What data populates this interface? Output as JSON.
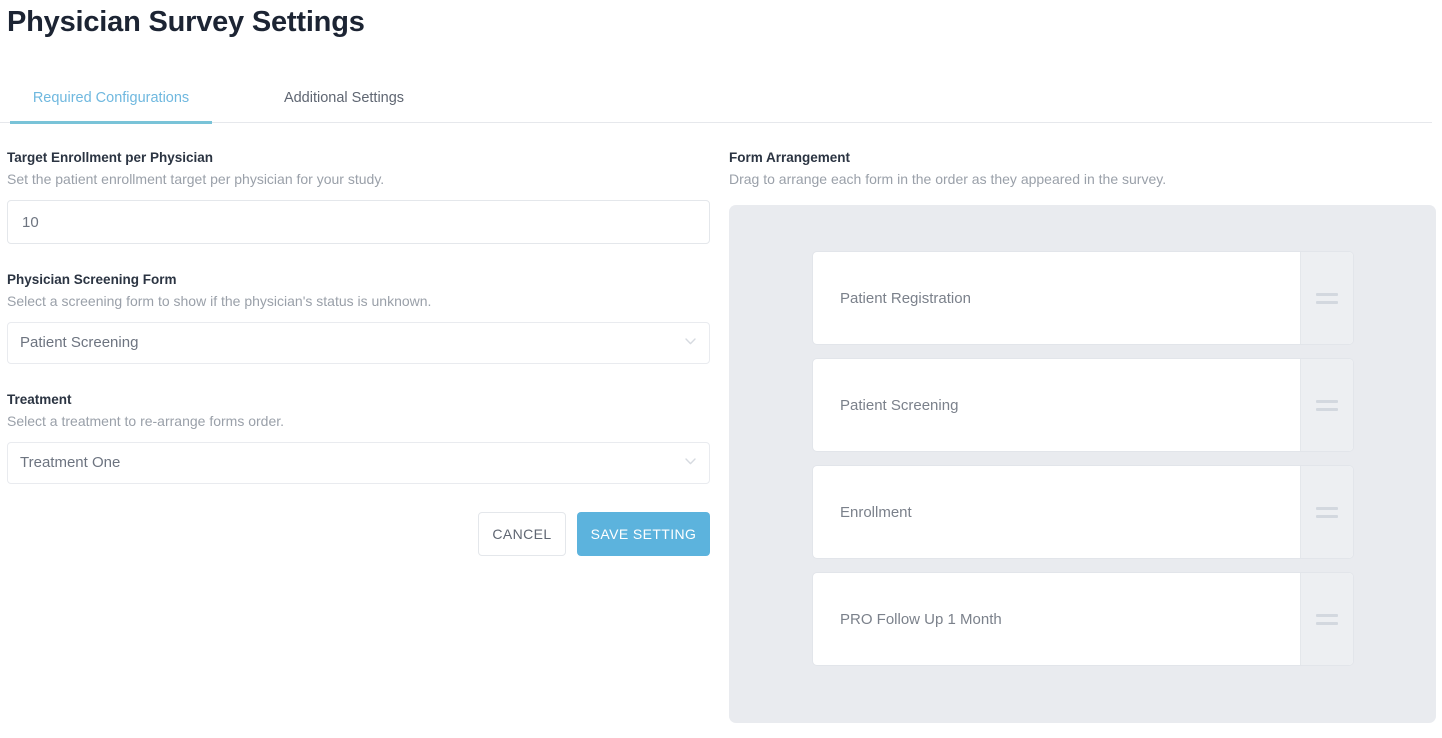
{
  "page": {
    "title": "Physician Survey Settings"
  },
  "tabs": [
    {
      "label": "Required Configurations",
      "active": true
    },
    {
      "label": "Additional Settings",
      "active": false
    }
  ],
  "left_column": {
    "target_enrollment": {
      "label": "Target Enrollment per Physician",
      "description": "Set the patient enrollment target per physician for your study.",
      "value": "10"
    },
    "screening_form": {
      "label": "Physician Screening Form",
      "description": "Select a screening form to show if the physician's status is unknown.",
      "selected": "Patient Screening"
    },
    "treatment": {
      "label": "Treatment",
      "description": "Select a treatment to re-arrange forms order.",
      "selected": "Treatment One"
    },
    "buttons": {
      "cancel": "CANCEL",
      "save": "SAVE SETTING"
    }
  },
  "right_column": {
    "label": "Form Arrangement",
    "description": "Drag to arrange each form in the order as they appeared in the survey.",
    "forms": [
      {
        "name": "Patient Registration"
      },
      {
        "name": "Patient Screening"
      },
      {
        "name": "Enrollment"
      },
      {
        "name": "PRO Follow Up 1 Month"
      }
    ],
    "drag_handle_icon": "drag-handle-icon"
  },
  "icons": {
    "chevron_down": "chevron-down-icon"
  },
  "colors": {
    "accent": "#5cb3dd",
    "tab_active": "#6fb8df",
    "tab_underline": "#79c3d8",
    "title": "#1c2433",
    "label": "#2b3442",
    "muted": "#9aa0a9",
    "panel_bg": "#e9ebef",
    "card_bg": "#ffffff",
    "drag_zone_bg": "#edeff2"
  }
}
